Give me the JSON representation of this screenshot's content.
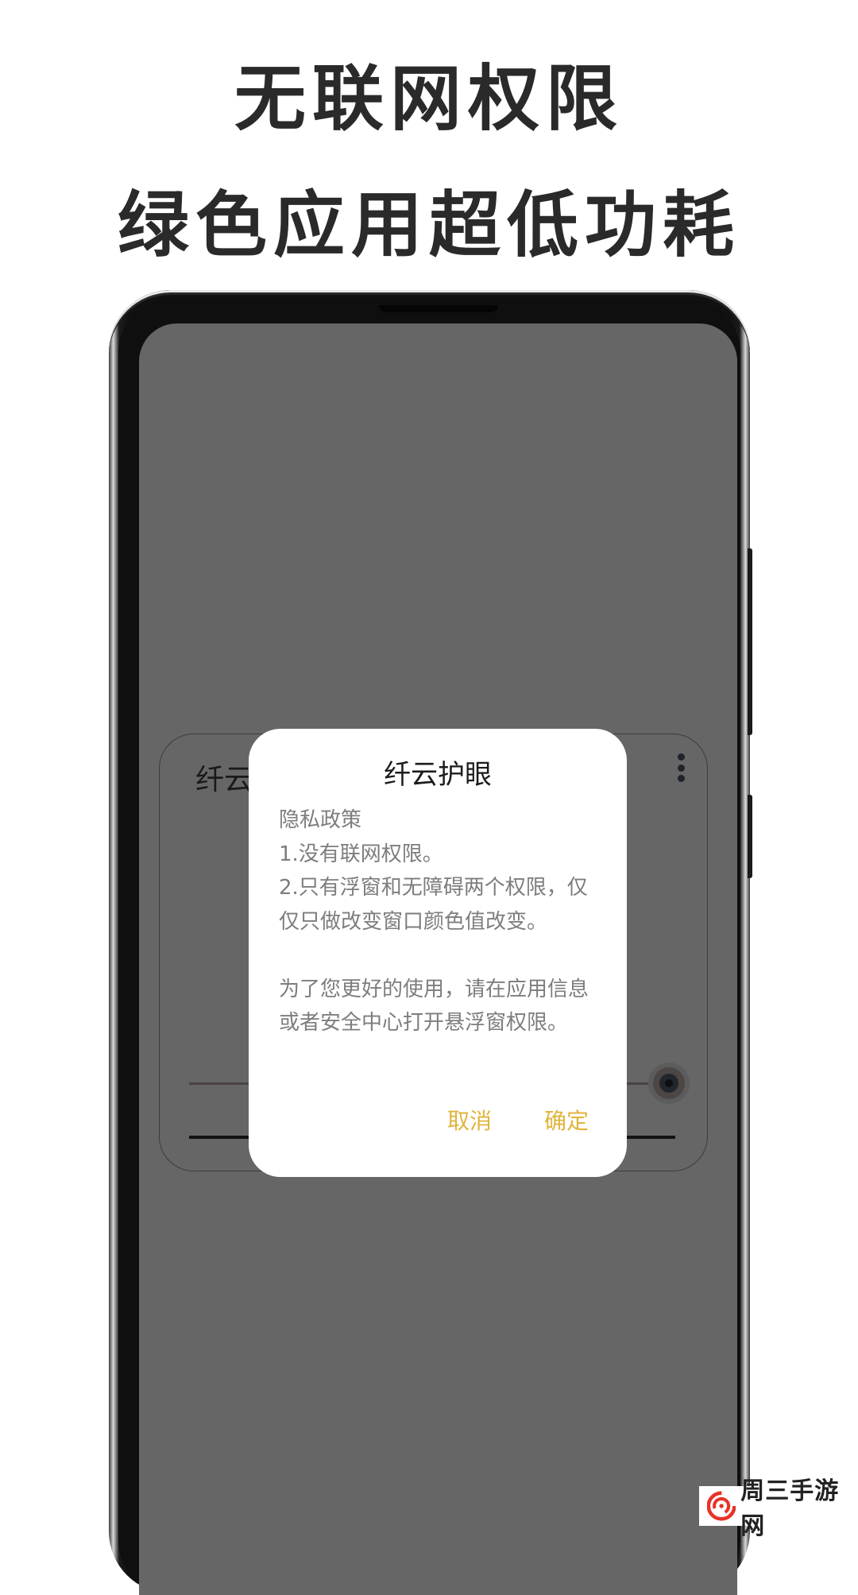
{
  "headline": {
    "line1": "无联网权限",
    "line2": "绿色应用超低功耗"
  },
  "app": {
    "title": "纤云护眼",
    "menu_icon": "more-vertical-icon",
    "sliders": [
      {
        "name": "slider-1"
      },
      {
        "name": "slider-2"
      }
    ]
  },
  "dialog": {
    "title": "纤云护眼",
    "body": "隐私政策\n1.没有联网权限。\n2.只有浮窗和无障碍两个权限，仅仅只做改变窗口颜色值改变。\n\n为了您更好的使用，请在应用信息或者安全中心打开悬浮窗权限。",
    "cancel_label": "取消",
    "confirm_label": "确定",
    "accent_color": "#e0b43c"
  },
  "watermark": {
    "text": "周三手游网"
  }
}
